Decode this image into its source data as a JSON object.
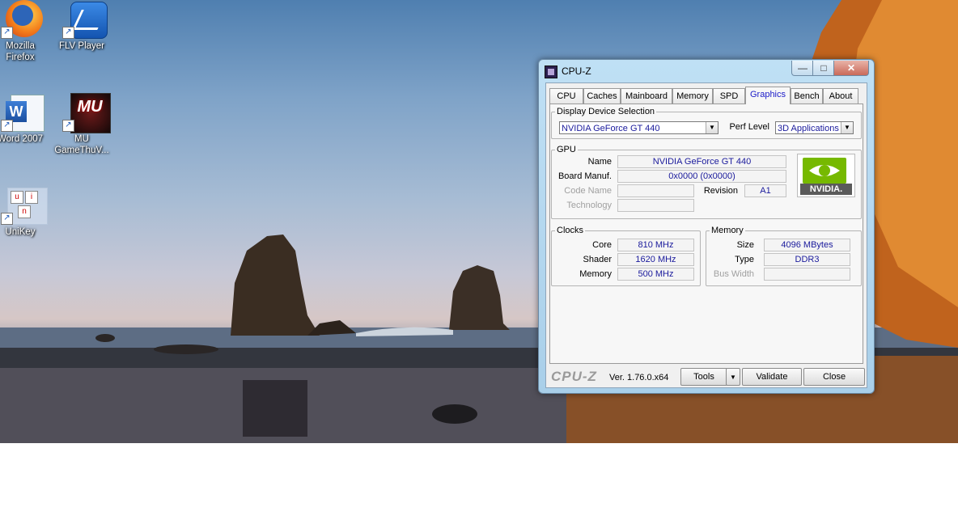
{
  "desktop": {
    "icons": [
      {
        "label_line1": "Mozilla",
        "label_line2": "Firefox",
        "icon": "firefox-icon"
      },
      {
        "label_line1": "FLV Player",
        "label_line2": "",
        "icon": "flv-player-icon"
      },
      {
        "label_line1": "Word 2007",
        "label_line2": "",
        "icon": "word-icon"
      },
      {
        "label_line1": "MU",
        "label_line2": "GameThuV...",
        "icon": "mu-game-icon"
      },
      {
        "label_line1": "UniKey",
        "label_line2": "",
        "icon": "unikey-icon"
      }
    ]
  },
  "window": {
    "title": "CPU-Z",
    "min_glyph": "—",
    "max_glyph": "□",
    "close_glyph": "✕"
  },
  "tabs": [
    "CPU",
    "Caches",
    "Mainboard",
    "Memory",
    "SPD",
    "Graphics",
    "Bench",
    "About"
  ],
  "active_tab": "Graphics",
  "display_device": {
    "legend": "Display Device Selection",
    "device": "NVIDIA GeForce GT 440",
    "perf_label": "Perf Level",
    "perf_value": "3D Applications"
  },
  "gpu": {
    "legend": "GPU",
    "name_label": "Name",
    "name": "NVIDIA GeForce GT 440",
    "board_label": "Board Manuf.",
    "board": "0x0000 (0x0000)",
    "codename_label": "Code Name",
    "codename": "",
    "revision_label": "Revision",
    "revision": "A1",
    "technology_label": "Technology",
    "technology": "",
    "logo_text": "NVIDIA."
  },
  "clocks": {
    "legend": "Clocks",
    "core_label": "Core",
    "core": "810 MHz",
    "shader_label": "Shader",
    "shader": "1620 MHz",
    "memory_label": "Memory",
    "memory": "500 MHz"
  },
  "memory": {
    "legend": "Memory",
    "size_label": "Size",
    "size": "4096 MBytes",
    "type_label": "Type",
    "type": "DDR3",
    "bus_label": "Bus Width",
    "bus": ""
  },
  "footer": {
    "brand": "CPU-Z",
    "version": "Ver. 1.76.0.x64",
    "tools": "Tools",
    "validate": "Validate",
    "close": "Close"
  }
}
